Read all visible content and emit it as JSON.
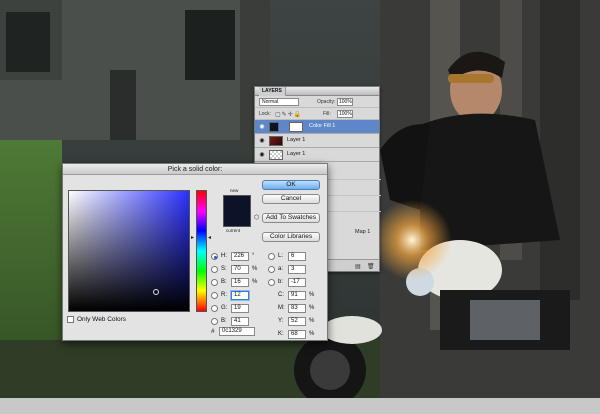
{
  "colors": {
    "picked": "#0c1329",
    "accent": "#5e87c9"
  },
  "layers_panel": {
    "tab": "LAYERS",
    "blend_mode": "Normal",
    "opacity_label": "Opacity:",
    "opacity_value": "100%",
    "lock_label": "Lock:",
    "fill_label": "Fill:",
    "fill_value": "100%",
    "layers": [
      {
        "name": "Color Fill 1",
        "selected": true
      },
      {
        "name": "Layer 1",
        "selected": false
      },
      {
        "name": "Layer 1",
        "selected": false
      }
    ],
    "map_label": "Map 1"
  },
  "picker": {
    "title": "Pick a solid color:",
    "new_label": "new",
    "current_label": "current",
    "buttons": {
      "ok": "OK",
      "cancel": "Cancel",
      "add_swatches": "Add To Swatches",
      "libraries": "Color Libraries"
    },
    "hsb": {
      "h": {
        "label": "H:",
        "value": "226",
        "unit": "°"
      },
      "s": {
        "label": "S:",
        "value": "70",
        "unit": "%"
      },
      "b": {
        "label": "B:",
        "value": "16",
        "unit": "%"
      }
    },
    "rgb": {
      "r": {
        "label": "R:",
        "value": "12"
      },
      "g": {
        "label": "G:",
        "value": "19"
      },
      "b": {
        "label": "B:",
        "value": "41"
      }
    },
    "lab": {
      "l": {
        "label": "L:",
        "value": "6"
      },
      "a": {
        "label": "a:",
        "value": "3"
      },
      "b": {
        "label": "b:",
        "value": "-17"
      }
    },
    "cmyk": {
      "c": {
        "label": "C:",
        "value": "91",
        "unit": "%"
      },
      "m": {
        "label": "M:",
        "value": "83",
        "unit": "%"
      },
      "y": {
        "label": "Y:",
        "value": "52",
        "unit": "%"
      },
      "k": {
        "label": "K:",
        "value": "68",
        "unit": "%"
      }
    },
    "only_web_colors": "Only Web Colors",
    "hash": "#",
    "hex": "0c1329"
  }
}
